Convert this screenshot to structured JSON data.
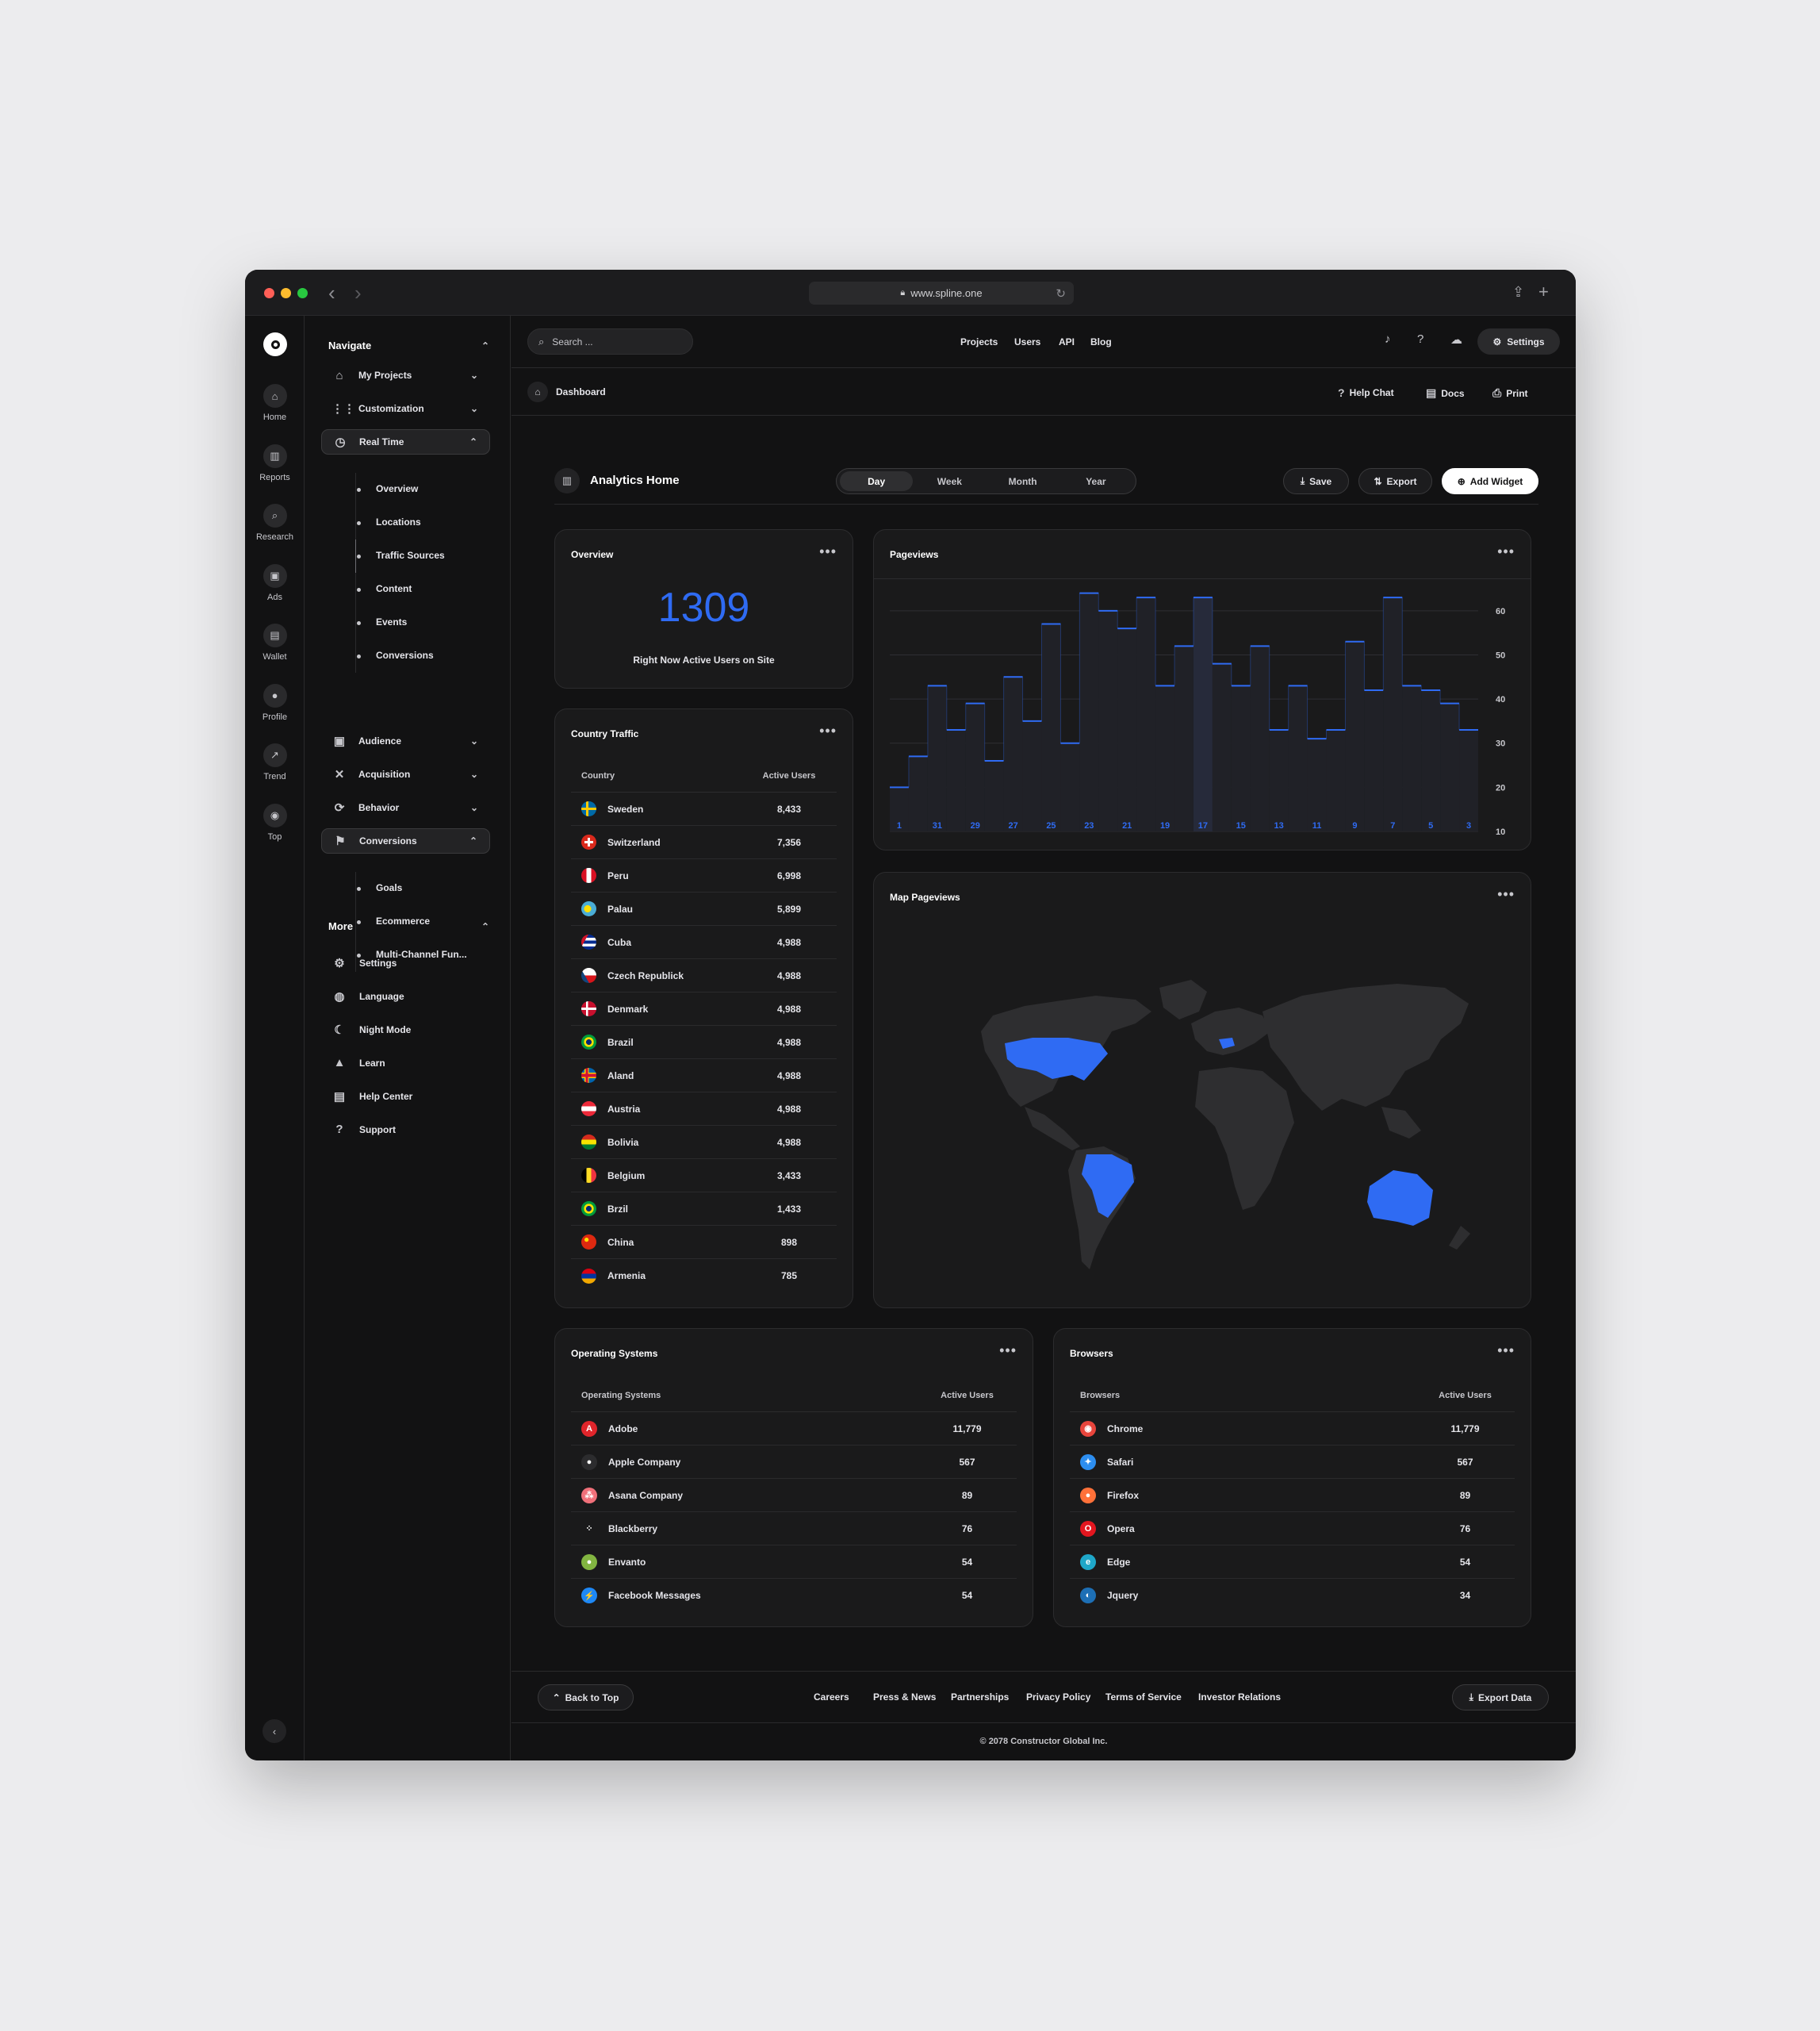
{
  "browser": {
    "url": "www.spline.one"
  },
  "rail": [
    {
      "label": "Home",
      "icon": "home-icon",
      "glyph": "⌂"
    },
    {
      "label": "Reports",
      "icon": "bar-chart-icon",
      "glyph": "▥"
    },
    {
      "label": "Research",
      "icon": "search-icon",
      "glyph": "⌕"
    },
    {
      "label": "Ads",
      "icon": "ads-icon",
      "glyph": "▣"
    },
    {
      "label": "Wallet",
      "icon": "wallet-icon",
      "glyph": "▤"
    },
    {
      "label": "Profile",
      "icon": "profile-icon",
      "glyph": "●"
    },
    {
      "label": "Trend",
      "icon": "trend-icon",
      "glyph": "↗"
    },
    {
      "label": "Top",
      "icon": "top-icon",
      "glyph": "◉"
    }
  ],
  "sidebar": {
    "navigate_title": "Navigate",
    "items": [
      {
        "label": "My Projects",
        "icon": "house-icon",
        "glyph": "⌂"
      },
      {
        "label": "Customization",
        "icon": "grid-icon",
        "glyph": "⋮⋮"
      },
      {
        "label": "Real Time",
        "icon": "clock-icon",
        "glyph": "◷"
      },
      {
        "label": "Audience",
        "icon": "audience-icon",
        "glyph": "▣"
      },
      {
        "label": "Acquisition",
        "icon": "acquisition-icon",
        "glyph": "✕"
      },
      {
        "label": "Behavior",
        "icon": "refresh-icon",
        "glyph": "⟳"
      },
      {
        "label": "Conversions",
        "icon": "flag-icon",
        "glyph": "⚑"
      }
    ],
    "realtime_sub": [
      "Overview",
      "Locations",
      "Traffic Sources",
      "Content",
      "Events",
      "Conversions"
    ],
    "conversions_sub": [
      "Goals",
      "Ecommerce",
      "Multi-Channel Fun..."
    ],
    "more_title": "More",
    "more": [
      {
        "label": "Settings",
        "icon": "gear-icon",
        "glyph": "⚙"
      },
      {
        "label": "Language",
        "icon": "globe-icon",
        "glyph": "◍"
      },
      {
        "label": "Night Mode",
        "icon": "moon-icon",
        "glyph": "☾"
      },
      {
        "label": "Learn",
        "icon": "graduation-cap-icon",
        "glyph": "▲"
      },
      {
        "label": "Help Center",
        "icon": "document-icon",
        "glyph": "▤"
      },
      {
        "label": "Support",
        "icon": "question-icon",
        "glyph": "?"
      }
    ]
  },
  "topbar": {
    "search_placeholder": "Search ...",
    "links": [
      "Projects",
      "Users",
      "API",
      "Blog"
    ],
    "settings": "Settings"
  },
  "crumb": {
    "label": "Dashboard",
    "help": "Help Chat",
    "docs": "Docs",
    "print": "Print"
  },
  "page": {
    "title": "Analytics Home",
    "periods": [
      "Day",
      "Week",
      "Month",
      "Year"
    ],
    "save": "Save",
    "export": "Export",
    "add_widget": "Add Widget"
  },
  "overview": {
    "title": "Overview",
    "value": "1309",
    "caption": "Right Now Active Users on Site"
  },
  "country": {
    "title": "Country Traffic",
    "col1": "Country",
    "col2": "Active Users",
    "rows": [
      {
        "name": "Sweden",
        "value": "8,433"
      },
      {
        "name": "Switzerland",
        "value": "7,356"
      },
      {
        "name": "Peru",
        "value": "6,998"
      },
      {
        "name": "Palau",
        "value": "5,899"
      },
      {
        "name": "Cuba",
        "value": "4,988"
      },
      {
        "name": "Czech Republick",
        "value": "4,988"
      },
      {
        "name": "Denmark",
        "value": "4,988"
      },
      {
        "name": "Brazil",
        "value": "4,988"
      },
      {
        "name": "Aland",
        "value": "4,988"
      },
      {
        "name": "Austria",
        "value": "4,988"
      },
      {
        "name": "Bolivia",
        "value": "4,988"
      },
      {
        "name": "Belgium",
        "value": "3,433"
      },
      {
        "name": "Brzil",
        "value": "1,433"
      },
      {
        "name": "China",
        "value": "898"
      },
      {
        "name": "Armenia",
        "value": "785"
      }
    ]
  },
  "pageviews": {
    "title": "Pageviews"
  },
  "map": {
    "title": "Map Pageviews"
  },
  "os": {
    "title": "Operating Systems",
    "col1": "Operating Systems",
    "col2": "Active Users",
    "rows": [
      {
        "name": "Adobe",
        "value": "11,779",
        "icon": "adobe-icon",
        "color": "#e0252b",
        "glyph": "A"
      },
      {
        "name": "Apple Company",
        "value": "567",
        "icon": "apple-icon",
        "color": "#2c2c2e",
        "glyph": "●"
      },
      {
        "name": "Asana Company",
        "value": "89",
        "icon": "asana-icon",
        "color": "#f0707a",
        "glyph": "⁂"
      },
      {
        "name": "Blackberry",
        "value": "76",
        "icon": "blackberry-icon",
        "color": "#1a1a1b",
        "glyph": "⁘"
      },
      {
        "name": "Envanto",
        "value": "54",
        "icon": "envato-icon",
        "color": "#82b541",
        "glyph": "●"
      },
      {
        "name": "Facebook Messages",
        "value": "54",
        "icon": "messenger-icon",
        "color": "#1e88f5",
        "glyph": "⚡"
      }
    ]
  },
  "browsers": {
    "title": "Browsers",
    "col1": "Browsers",
    "col2": "Active Users",
    "rows": [
      {
        "name": "Chrome",
        "value": "11,779",
        "icon": "chrome-icon",
        "color": "#e8453c",
        "glyph": "◉"
      },
      {
        "name": "Safari",
        "value": "567",
        "icon": "safari-icon",
        "color": "#2d8ef0",
        "glyph": "✦"
      },
      {
        "name": "Firefox",
        "value": "89",
        "icon": "firefox-icon",
        "color": "#ff7139",
        "glyph": "●"
      },
      {
        "name": "Opera",
        "value": "76",
        "icon": "opera-icon",
        "color": "#e3161f",
        "glyph": "O"
      },
      {
        "name": "Edge",
        "value": "54",
        "icon": "edge-icon",
        "color": "#1fa7c9",
        "glyph": "e"
      },
      {
        "name": "Jquery",
        "value": "34",
        "icon": "jquery-icon",
        "color": "#1d6fb5",
        "glyph": "◐"
      }
    ]
  },
  "footer": {
    "back": "Back to Top",
    "links": [
      "Careers",
      "Press & News",
      "Partnerships",
      "Privacy Policy",
      "Terms of Service",
      "Investor Relations"
    ],
    "export": "Export Data",
    "copyright": "© 2078 Constructor Global Inc."
  },
  "chart_data": {
    "type": "bar",
    "title": "Pageviews",
    "categories": [
      "1",
      "",
      "31",
      "",
      "29",
      "",
      "27",
      "",
      "25",
      "",
      "23",
      "",
      "21",
      "",
      "19",
      "",
      "17",
      "",
      "15",
      "",
      "13",
      "",
      "11",
      "",
      "9",
      "",
      "7",
      "",
      "5",
      "",
      "3",
      ""
    ],
    "values": [
      20,
      27,
      43,
      33,
      39,
      26,
      45,
      35,
      57,
      30,
      64,
      60,
      56,
      63,
      43,
      52,
      63,
      48,
      43,
      52,
      33,
      43,
      31,
      33,
      53,
      42,
      63,
      43,
      42,
      39,
      33
    ],
    "highlight_index": 16,
    "yticks": [
      10,
      20,
      30,
      40,
      50,
      60
    ],
    "ylim": [
      10,
      65
    ],
    "color": "#2f6bf3",
    "grid": true
  }
}
